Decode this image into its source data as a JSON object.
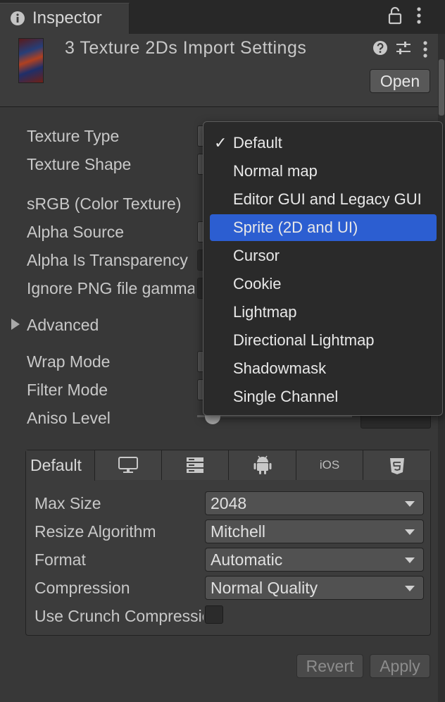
{
  "tab": {
    "title": "Inspector"
  },
  "header": {
    "title": "3 Texture 2Ds Import Settings",
    "open_label": "Open"
  },
  "properties": [
    "Texture Type",
    "Texture Shape",
    "sRGB (Color Texture)",
    "Alpha Source",
    "Alpha Is Transparency",
    "Ignore PNG file gamma",
    "Advanced",
    "Wrap Mode",
    "Filter Mode",
    "Aniso Level"
  ],
  "texture_type_dropdown": {
    "check_mark": "✓",
    "items": [
      "Default",
      "Normal map",
      "Editor GUI and Legacy GUI",
      "Sprite (2D and UI)",
      "Cursor",
      "Cookie",
      "Lightmap",
      "Directional Lightmap",
      "Shadowmask",
      "Single Channel"
    ],
    "checked_index": 0,
    "highlighted_index": 3
  },
  "platform": {
    "tabs": [
      {
        "label": "Default",
        "icon": ""
      },
      {
        "label": "",
        "icon": "monitor-icon"
      },
      {
        "label": "",
        "icon": "server-icon"
      },
      {
        "label": "",
        "icon": "android-icon"
      },
      {
        "label": "iOS",
        "icon": ""
      },
      {
        "label": "",
        "icon": "html5-icon"
      }
    ],
    "rows": [
      {
        "label": "Max Size",
        "value": "2048"
      },
      {
        "label": "Resize Algorithm",
        "value": "Mitchell"
      },
      {
        "label": "Format",
        "value": "Automatic"
      },
      {
        "label": "Compression",
        "value": "Normal Quality"
      }
    ],
    "crunch_label": "Use Crunch Compression"
  },
  "footer": {
    "revert_label": "Revert",
    "apply_label": "Apply"
  },
  "colors": {
    "background": "#383838",
    "selection": "#2c5ed1",
    "popup": "#2a2a2a"
  }
}
